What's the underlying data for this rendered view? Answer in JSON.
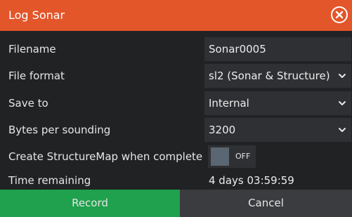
{
  "dialog": {
    "title": "Log Sonar",
    "close_icon": "close-circle-icon",
    "accent_color": "#e3562a"
  },
  "fields": {
    "filename": {
      "label": "Filename",
      "value": "Sonar0005"
    },
    "file_format": {
      "label": "File format",
      "value": "sl2 (Sonar & Structure)"
    },
    "save_to": {
      "label": "Save to",
      "value": "Internal"
    },
    "bytes_per_sounding": {
      "label": "Bytes per sounding",
      "value": "3200"
    },
    "structuremap": {
      "label": "Create StructureMap when complete",
      "toggle_text": "OFF",
      "state": false
    },
    "time_remaining": {
      "label": "Time remaining",
      "value": "4 days 03:59:59"
    }
  },
  "buttons": {
    "record": {
      "label": "Record",
      "color": "#1fa14d"
    },
    "cancel": {
      "label": "Cancel",
      "color": "#3b3c3f"
    }
  }
}
